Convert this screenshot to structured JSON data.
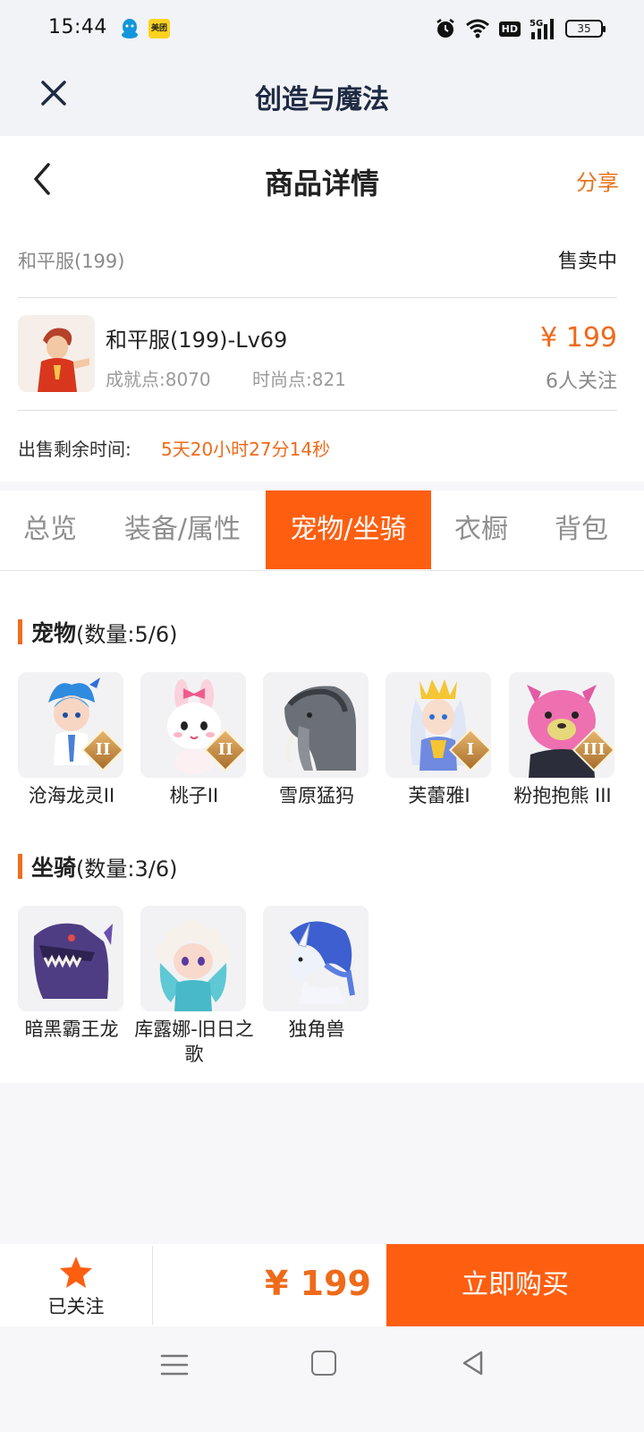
{
  "status_bar": {
    "time": "15:44",
    "meituan_label": "美团",
    "hd": "HD",
    "network": "5G",
    "battery": "35"
  },
  "app_header": {
    "title": "创造与魔法"
  },
  "page_header": {
    "title": "商品详情",
    "share": "分享"
  },
  "item": {
    "name": "和平服(199)",
    "status": "售卖中",
    "title": "和平服(199)-Lv69",
    "achievement": "成就点:8070",
    "fashion": "时尚点:821",
    "price": "¥ 199",
    "followers": "6人关注",
    "remain_label": "出售剩余时间:",
    "remain_value": "5天20小时27分14秒"
  },
  "tabs": [
    "总览",
    "装备/属性",
    "宠物/坐骑",
    "衣橱",
    "背包"
  ],
  "active_tab": 2,
  "pets_section": {
    "label": "宠物",
    "count": "(数量:5/6)"
  },
  "pets": [
    {
      "name": "沧海龙灵II",
      "rank": "II"
    },
    {
      "name": "桃子II",
      "rank": "II"
    },
    {
      "name": "雪原猛犸",
      "rank": ""
    },
    {
      "name": "芙蕾雅I",
      "rank": "I"
    },
    {
      "name": "粉抱抱熊 III",
      "rank": "III"
    }
  ],
  "mounts_section": {
    "label": "坐骑",
    "count": "(数量:3/6)"
  },
  "mounts": [
    {
      "name": "暗黑霸王龙"
    },
    {
      "name": "库露娜-旧日之歌"
    },
    {
      "name": "独角兽"
    }
  ],
  "bottom_bar": {
    "follow_label": "已关注",
    "price": "¥ 199",
    "buy_label": "立即购买"
  },
  "colors": {
    "accent": "#fe5e10",
    "price": "#ef6a1a",
    "header_bg": "#f1f3f6"
  },
  "icons": [
    "close-icon",
    "back-icon",
    "star-icon",
    "alarm-icon",
    "wifi-icon",
    "signal-icon",
    "battery-icon",
    "menu-icon",
    "home-icon",
    "nav-back-icon"
  ]
}
